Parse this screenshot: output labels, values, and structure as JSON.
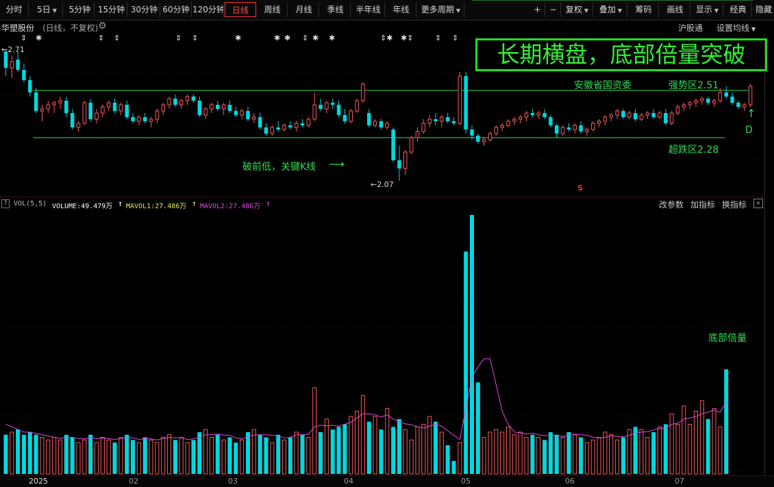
{
  "toolbar": {
    "periods": [
      "分时",
      "5日",
      "5分钟",
      "15分钟",
      "30分钟",
      "60分钟",
      "120分钟",
      "日线",
      "周线",
      "月线",
      "季线",
      "半年线",
      "年线",
      "更多周期"
    ],
    "active_period": "日线",
    "right_buttons": [
      "+",
      "−",
      "复权",
      "叠加",
      "筹码",
      "画线",
      "显示",
      "经典",
      "隐藏"
    ]
  },
  "info": {
    "stock_name": "华塑股份",
    "mode": "(日线，不复权)",
    "hk_connect": "沪股通",
    "ma_settings": "设置均线"
  },
  "annotations": {
    "title": "长期横盘，底部倍量突破",
    "high_marker": "2.71",
    "low_marker": "2.07",
    "owner": "安徽省国资委",
    "strong_zone": "强势区2.51",
    "oversold_zone": "超跌区2.28",
    "break_low": "破前低，关键K线",
    "d_label": "D",
    "volume_note": "底部倍量",
    "s_marker": "S"
  },
  "volume_panel": {
    "help": "?",
    "name": "VOL(5,5)",
    "volume": "VOLUME:49.479万",
    "mavol1": "MAVOL1:27.486万",
    "mavol2": "MAVOL2:27.486万",
    "actions": [
      "改参数",
      "加指标",
      "换指标"
    ],
    "close": "✕"
  },
  "x_axis": [
    "2025",
    "02",
    "03",
    "04",
    "05",
    "06",
    "07"
  ],
  "colors": {
    "up": "#ff5a5a",
    "down": "#00d8e0",
    "ma1": "#e8e85a",
    "ma2": "#e24ae2",
    "accent": "#ff3030",
    "annotation": "#33dd55"
  },
  "chart_data": {
    "type": "candlestick",
    "y_range": [
      2.05,
      2.73
    ],
    "levels": {
      "strong": 2.51,
      "oversold": 2.28
    },
    "candles": [
      [
        2.7,
        2.71,
        2.58,
        2.62
      ],
      [
        2.62,
        2.68,
        2.57,
        2.65
      ],
      [
        2.66,
        2.7,
        2.6,
        2.61
      ],
      [
        2.61,
        2.64,
        2.55,
        2.56
      ],
      [
        2.56,
        2.58,
        2.48,
        2.5
      ],
      [
        2.5,
        2.52,
        2.4,
        2.41
      ],
      [
        2.41,
        2.44,
        2.36,
        2.42
      ],
      [
        2.42,
        2.46,
        2.4,
        2.44
      ],
      [
        2.44,
        2.46,
        2.4,
        2.45
      ],
      [
        2.45,
        2.48,
        2.42,
        2.46
      ],
      [
        2.46,
        2.48,
        2.38,
        2.4
      ],
      [
        2.4,
        2.42,
        2.32,
        2.33
      ],
      [
        2.33,
        2.36,
        2.31,
        2.35
      ],
      [
        2.35,
        2.46,
        2.34,
        2.45
      ],
      [
        2.45,
        2.47,
        2.36,
        2.37
      ],
      [
        2.37,
        2.42,
        2.35,
        2.4
      ],
      [
        2.4,
        2.44,
        2.38,
        2.43
      ],
      [
        2.43,
        2.46,
        2.41,
        2.45
      ],
      [
        2.45,
        2.47,
        2.4,
        2.41
      ],
      [
        2.41,
        2.45,
        2.39,
        2.44
      ],
      [
        2.44,
        2.46,
        2.37,
        2.38
      ],
      [
        2.38,
        2.4,
        2.35,
        2.36
      ],
      [
        2.36,
        2.39,
        2.34,
        2.38
      ],
      [
        2.38,
        2.4,
        2.35,
        2.36
      ],
      [
        2.36,
        2.38,
        2.33,
        2.37
      ],
      [
        2.37,
        2.42,
        2.35,
        2.41
      ],
      [
        2.41,
        2.45,
        2.39,
        2.44
      ],
      [
        2.44,
        2.48,
        2.42,
        2.47
      ],
      [
        2.47,
        2.49,
        2.43,
        2.44
      ],
      [
        2.44,
        2.47,
        2.42,
        2.46
      ],
      [
        2.46,
        2.49,
        2.44,
        2.48
      ],
      [
        2.48,
        2.49,
        2.45,
        2.46
      ],
      [
        2.46,
        2.48,
        2.38,
        2.39
      ],
      [
        2.39,
        2.43,
        2.37,
        2.42
      ],
      [
        2.42,
        2.45,
        2.4,
        2.44
      ],
      [
        2.44,
        2.46,
        2.41,
        2.42
      ],
      [
        2.42,
        2.45,
        2.39,
        2.44
      ],
      [
        2.44,
        2.46,
        2.4,
        2.41
      ],
      [
        2.41,
        2.43,
        2.38,
        2.39
      ],
      [
        2.39,
        2.42,
        2.37,
        2.41
      ],
      [
        2.41,
        2.43,
        2.36,
        2.37
      ],
      [
        2.37,
        2.4,
        2.35,
        2.38
      ],
      [
        2.38,
        2.4,
        2.32,
        2.33
      ],
      [
        2.33,
        2.35,
        2.29,
        2.3
      ],
      [
        2.3,
        2.34,
        2.29,
        2.33
      ],
      [
        2.33,
        2.36,
        2.31,
        2.32
      ],
      [
        2.32,
        2.35,
        2.31,
        2.34
      ],
      [
        2.34,
        2.36,
        2.32,
        2.33
      ],
      [
        2.33,
        2.36,
        2.31,
        2.35
      ],
      [
        2.35,
        2.37,
        2.33,
        2.34
      ],
      [
        2.34,
        2.38,
        2.33,
        2.37
      ],
      [
        2.37,
        2.5,
        2.36,
        2.44
      ],
      [
        2.44,
        2.47,
        2.41,
        2.42
      ],
      [
        2.42,
        2.46,
        2.4,
        2.45
      ],
      [
        2.45,
        2.47,
        2.42,
        2.44
      ],
      [
        2.44,
        2.46,
        2.38,
        2.39
      ],
      [
        2.39,
        2.42,
        2.35,
        2.36
      ],
      [
        2.36,
        2.42,
        2.35,
        2.41
      ],
      [
        2.41,
        2.47,
        2.4,
        2.46
      ],
      [
        2.46,
        2.55,
        2.45,
        2.54
      ],
      [
        2.4,
        2.42,
        2.33,
        2.34
      ],
      [
        2.34,
        2.37,
        2.33,
        2.36
      ],
      [
        2.36,
        2.37,
        2.32,
        2.33
      ],
      [
        2.33,
        2.36,
        2.32,
        2.35
      ],
      [
        2.32,
        2.33,
        2.16,
        2.17
      ],
      [
        2.17,
        2.24,
        2.07,
        2.13
      ],
      [
        2.13,
        2.22,
        2.1,
        2.21
      ],
      [
        2.21,
        2.29,
        2.2,
        2.28
      ],
      [
        2.28,
        2.33,
        2.26,
        2.31
      ],
      [
        2.31,
        2.37,
        2.3,
        2.35
      ],
      [
        2.35,
        2.39,
        2.33,
        2.37
      ],
      [
        2.37,
        2.4,
        2.34,
        2.36
      ],
      [
        2.36,
        2.39,
        2.33,
        2.38
      ],
      [
        2.38,
        2.4,
        2.35,
        2.36
      ],
      [
        2.36,
        2.38,
        2.34,
        2.35
      ],
      [
        2.35,
        2.6,
        2.34,
        2.58
      ],
      [
        2.58,
        2.6,
        2.3,
        2.32
      ],
      [
        2.32,
        2.34,
        2.27,
        2.29
      ],
      [
        2.29,
        2.3,
        2.25,
        2.26
      ],
      [
        2.26,
        2.28,
        2.24,
        2.27
      ],
      [
        2.27,
        2.31,
        2.26,
        2.3
      ],
      [
        2.3,
        2.34,
        2.29,
        2.33
      ],
      [
        2.33,
        2.35,
        2.31,
        2.34
      ],
      [
        2.34,
        2.37,
        2.33,
        2.36
      ],
      [
        2.36,
        2.38,
        2.34,
        2.37
      ],
      [
        2.37,
        2.39,
        2.35,
        2.38
      ],
      [
        2.38,
        2.41,
        2.36,
        2.4
      ],
      [
        2.4,
        2.42,
        2.38,
        2.39
      ],
      [
        2.39,
        2.41,
        2.37,
        2.4
      ],
      [
        2.4,
        2.42,
        2.37,
        2.38
      ],
      [
        2.38,
        2.39,
        2.33,
        2.34
      ],
      [
        2.34,
        2.35,
        2.28,
        2.3
      ],
      [
        2.3,
        2.34,
        2.29,
        2.33
      ],
      [
        2.33,
        2.35,
        2.31,
        2.32
      ],
      [
        2.32,
        2.35,
        2.3,
        2.34
      ],
      [
        2.34,
        2.36,
        2.3,
        2.31
      ],
      [
        2.31,
        2.33,
        2.29,
        2.32
      ],
      [
        2.32,
        2.36,
        2.31,
        2.35
      ],
      [
        2.35,
        2.37,
        2.33,
        2.36
      ],
      [
        2.36,
        2.39,
        2.34,
        2.38
      ],
      [
        2.38,
        2.4,
        2.36,
        2.39
      ],
      [
        2.39,
        2.42,
        2.37,
        2.41
      ],
      [
        2.41,
        2.42,
        2.37,
        2.38
      ],
      [
        2.38,
        2.41,
        2.37,
        2.4
      ],
      [
        2.4,
        2.42,
        2.36,
        2.37
      ],
      [
        2.37,
        2.4,
        2.36,
        2.39
      ],
      [
        2.39,
        2.41,
        2.37,
        2.4
      ],
      [
        2.4,
        2.42,
        2.37,
        2.38
      ],
      [
        2.38,
        2.41,
        2.37,
        2.4
      ],
      [
        2.4,
        2.42,
        2.34,
        2.35
      ],
      [
        2.35,
        2.41,
        2.34,
        2.4
      ],
      [
        2.4,
        2.44,
        2.39,
        2.43
      ],
      [
        2.43,
        2.45,
        2.41,
        2.44
      ],
      [
        2.44,
        2.46,
        2.42,
        2.45
      ],
      [
        2.45,
        2.47,
        2.43,
        2.46
      ],
      [
        2.46,
        2.48,
        2.44,
        2.47
      ],
      [
        2.47,
        2.48,
        2.44,
        2.45
      ],
      [
        2.45,
        2.47,
        2.43,
        2.46
      ],
      [
        2.46,
        2.52,
        2.45,
        2.5
      ],
      [
        2.5,
        2.53,
        2.47,
        2.48
      ],
      [
        2.48,
        2.5,
        2.44,
        2.45
      ],
      [
        2.45,
        2.46,
        2.42,
        2.43
      ],
      [
        2.43,
        2.45,
        2.41,
        2.44
      ],
      [
        2.44,
        2.54,
        2.43,
        2.53
      ]
    ],
    "volume": [
      15,
      16,
      17,
      15,
      16,
      15,
      14,
      13,
      14,
      13,
      15,
      14,
      12,
      13,
      15,
      12,
      14,
      13,
      12,
      14,
      15,
      13,
      12,
      14,
      13,
      12,
      14,
      15,
      13,
      14,
      12,
      13,
      16,
      17,
      14,
      15,
      13,
      14,
      12,
      13,
      16,
      17,
      15,
      14,
      12,
      15,
      13,
      14,
      16,
      15,
      14,
      33,
      16,
      21,
      17,
      18,
      19,
      22,
      24,
      30,
      20,
      22,
      17,
      25,
      18,
      21,
      17,
      13,
      18,
      19,
      22,
      20,
      16,
      11,
      5,
      12,
      85,
      99,
      35,
      14,
      16,
      17,
      16,
      18,
      15,
      16,
      14,
      15,
      14,
      13,
      16,
      15,
      14,
      16,
      15,
      14,
      12,
      13,
      14,
      16,
      15,
      13,
      14,
      17,
      18,
      17,
      14,
      16,
      18,
      19,
      23,
      19,
      26,
      19,
      24,
      28,
      21,
      25,
      18,
      40
    ],
    "mavol1": [
      19,
      18,
      17,
      16,
      16,
      15.5,
      15,
      14.5,
      14,
      13.6,
      14,
      14,
      13.5,
      13.4,
      13.8,
      13.5,
      13.8,
      13.5,
      13.2,
      13.5,
      14,
      13.8,
      13.2,
      13.5,
      13.4,
      13,
      13.5,
      14,
      13.8,
      13.9,
      13.2,
      13.4,
      14,
      15,
      15,
      15.3,
      14.9,
      14.8,
      13.8,
      13.4,
      14.2,
      14.9,
      15,
      15,
      14.8,
      14.6,
      13.8,
      14,
      15,
      15,
      15.2,
      18,
      18.6,
      18.4,
      18.6,
      18.2,
      19,
      19.8,
      21.4,
      23,
      23,
      22.6,
      21.8,
      22.6,
      21,
      19.8,
      19.2,
      18.8,
      18,
      17.6,
      18.3,
      19,
      18.3,
      16.5,
      14.8,
      13.2,
      25,
      37,
      41,
      44,
      44,
      34,
      24,
      19,
      16,
      15.8,
      15.2,
      15.6,
      15,
      14.6,
      14.8,
      14.6,
      14.4,
      14.8,
      15.2,
      15,
      14.8,
      14,
      13.8,
      14,
      14.6,
      14.4,
      14.2,
      14.8,
      15.6,
      16,
      16.2,
      16.8,
      17.4,
      17.6,
      19,
      19.4,
      21,
      21.4,
      22,
      23,
      23.6,
      24.4,
      23.6,
      27.5
    ],
    "mavol2": [
      19,
      18,
      17,
      16,
      16,
      15.5,
      15,
      14.5,
      14,
      13.6,
      14,
      14,
      13.5,
      13.4,
      13.8,
      13.5,
      13.8,
      13.5,
      13.2,
      13.5,
      14,
      13.8,
      13.2,
      13.5,
      13.4,
      13,
      13.5,
      14,
      13.8,
      13.9,
      13.2,
      13.4,
      14,
      15,
      15,
      15.3,
      14.9,
      14.8,
      13.8,
      13.4,
      14.2,
      14.9,
      15,
      15,
      14.8,
      14.6,
      13.8,
      14,
      15,
      15,
      15.2,
      18,
      18.6,
      18.4,
      18.6,
      18.2,
      19,
      19.8,
      21.4,
      23,
      23,
      22.6,
      21.8,
      22.6,
      21,
      19.8,
      19.2,
      18.8,
      18,
      17.6,
      18.3,
      19,
      18.3,
      16.5,
      14.8,
      13.2,
      25,
      37,
      41,
      44,
      44,
      34,
      24,
      19,
      16,
      15.8,
      15.2,
      15.6,
      15,
      14.6,
      14.8,
      14.6,
      14.4,
      14.8,
      15.2,
      15,
      14.8,
      14,
      13.8,
      14,
      14.6,
      14.4,
      14.2,
      14.8,
      15.6,
      16,
      16.2,
      16.8,
      17.4,
      17.6,
      19,
      19.4,
      21,
      21.4,
      22,
      23,
      23.6,
      24.4,
      23.6,
      27.5
    ],
    "volume_y_range": [
      0,
      100
    ]
  }
}
